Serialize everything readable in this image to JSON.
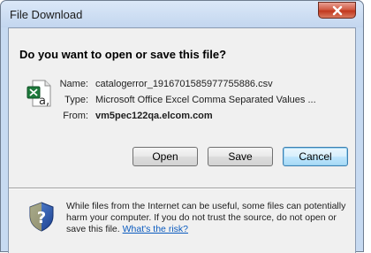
{
  "window": {
    "title": "File Download"
  },
  "dialog": {
    "question": "Do you want to open or save this file?",
    "fields": {
      "name_label": "Name:",
      "name_value": "catalogerror_1916701585977755886.csv",
      "type_label": "Type:",
      "type_value": "Microsoft Office Excel Comma Separated Values ...",
      "from_label": "From:",
      "from_value": "vm5pec122qa.elcom.com"
    },
    "buttons": {
      "open": "Open",
      "save": "Save",
      "cancel": "Cancel"
    },
    "warning": {
      "text": "While files from the Internet can be useful, some files can potentially harm your computer. If you do not trust the source, do not open or save this file.",
      "link": "What's the risk?"
    }
  },
  "icons": {
    "close": "close-icon",
    "file": "excel-csv-file-icon",
    "warning": "security-shield-icon"
  },
  "colors": {
    "title_bar": "#c7daf1",
    "close_button": "#c2381e",
    "dialog_body": "#f0f0f0",
    "link": "#0b5bbf",
    "default_button": "#bee6fd"
  }
}
